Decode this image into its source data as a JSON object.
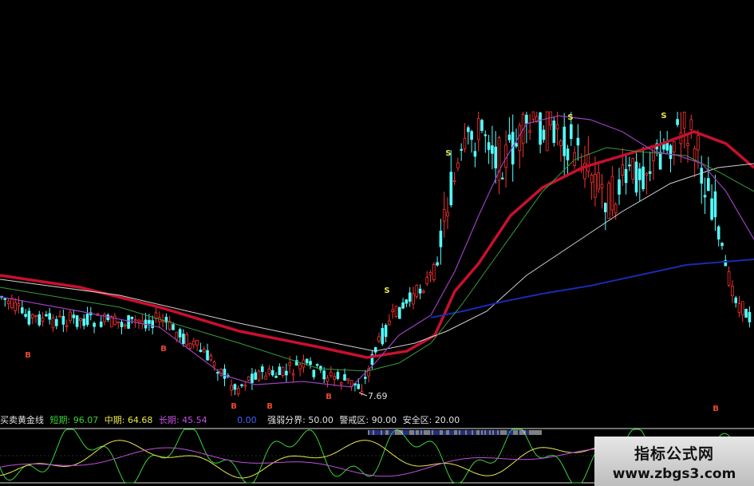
{
  "colors": {
    "background": "#000000",
    "up": "#ff3030",
    "down": "#54ffff",
    "ma_red": "#c8102e",
    "ma_white": "#cfcfcf",
    "ma_blue": "#1a2bb0",
    "ma_green": "#3a9a3a",
    "ma_purple": "#9b3fbf",
    "signal_s": "#e8e84a",
    "signal_b": "#e84a2e"
  },
  "price_labels": {
    "low_price": "7.69"
  },
  "signals": {
    "s_label": "S",
    "b_label": "B"
  },
  "info_bar": {
    "indicator_name": "买卖黄金线",
    "short_label": "短期:",
    "short_value": "96.07",
    "mid_label": "中期:",
    "mid_value": "64.68",
    "long_label": "长期:",
    "long_value": "45.54",
    "extra_value": "0.00",
    "strong_weak_label": "强弱分界:",
    "strong_weak_value": "50.00",
    "alert_label": "警戒区:",
    "alert_value": "90.00",
    "safe_label": "安全区:",
    "safe_value": "20.00"
  },
  "watermark": {
    "title": "指标公式网",
    "url": "www.zbgs3.com"
  }
}
